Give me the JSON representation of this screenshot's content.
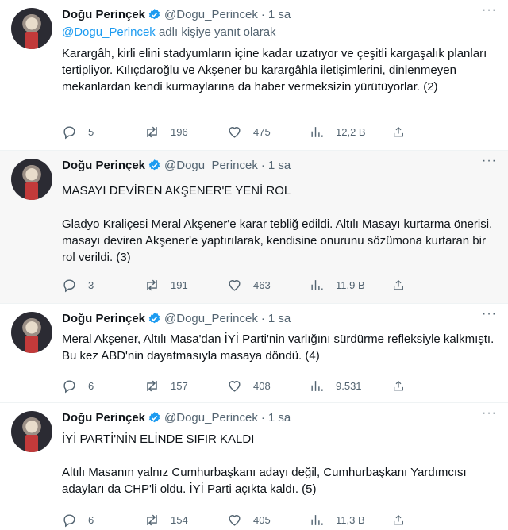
{
  "tweets": [
    {
      "name": "Doğu Perinçek",
      "handle": "@Dogu_Perincek",
      "time": "1 sa",
      "reply_mention": "@Dogu_Perincek",
      "reply_suffix": " adlı kişiye yanıt olarak",
      "paragraphs": [
        "Karargâh, kirli elini stadyumların içine kadar uzatıyor ve çeşitli kargaşalık planları tertipliyor. Kılıçdaroğlu ve Akşener bu karargâhla iletişimlerini, dinlenmeyen mekanlardan kendi kurmaylarına da haber vermeksizin yürütüyorlar. (2)"
      ],
      "replies": "5",
      "retweets": "196",
      "likes": "475",
      "views": "12,2 B"
    },
    {
      "name": "Doğu Perinçek",
      "handle": "@Dogu_Perincek",
      "time": "1 sa",
      "paragraphs": [
        "MASAYI DEVİREN AKŞENER'E YENİ ROL",
        "Gladyo Kraliçesi Meral Akşener'e karar tebliğ edildi. Altılı Masayı kurtarma önerisi, masayı deviren Akşener'e yaptırılarak, kendisine onurunu sözümona kurtaran bir rol verildi. (3)"
      ],
      "replies": "3",
      "retweets": "191",
      "likes": "463",
      "views": "11,9 B"
    },
    {
      "name": "Doğu Perinçek",
      "handle": "@Dogu_Perincek",
      "time": "1 sa",
      "paragraphs": [
        "Meral Akşener, Altılı Masa'dan İYİ Parti'nin varlığını sürdürme refleksiyle kalkmıştı. Bu kez ABD'nin dayatmasıyla masaya döndü. (4)"
      ],
      "replies": "6",
      "retweets": "157",
      "likes": "408",
      "views": "9.531"
    },
    {
      "name": "Doğu Perinçek",
      "handle": "@Dogu_Perincek",
      "time": "1 sa",
      "paragraphs": [
        "İYİ PARTİ'NİN ELİNDE SIFIR KALDI",
        "Altılı Masanın yalnız Cumhurbaşkanı adayı değil, Cumhurbaşkanı Yardımcısı adayları da CHP'li oldu. İYİ Parti açıkta kaldı. (5)"
      ],
      "replies": "6",
      "retweets": "154",
      "likes": "405",
      "views": "11,3 B"
    }
  ],
  "dot": "·",
  "more": "···",
  "colors": {
    "accent": "#1d9bf0",
    "muted": "#536471",
    "text": "#0f1419"
  },
  "icons": {
    "verified": "verified-badge-icon",
    "reply": "reply-icon",
    "retweet": "retweet-icon",
    "like": "heart-icon",
    "views": "views-icon",
    "share": "share-icon",
    "more": "more-icon"
  }
}
